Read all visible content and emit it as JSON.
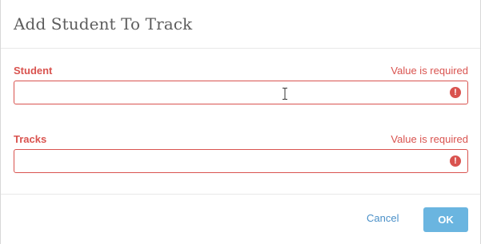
{
  "dialog": {
    "title": "Add Student To Track"
  },
  "fields": {
    "student": {
      "label": "Student",
      "error": "Value is required",
      "value": "",
      "placeholder": ""
    },
    "tracks": {
      "label": "Tracks",
      "error": "Value is required",
      "value": "",
      "placeholder": ""
    },
    "error_icon_glyph": "!"
  },
  "footer": {
    "cancel_label": "Cancel",
    "ok_label": "OK"
  },
  "colors": {
    "error": "#d9534f",
    "link": "#4a90c8",
    "primary_button": "#6ab5e0"
  }
}
